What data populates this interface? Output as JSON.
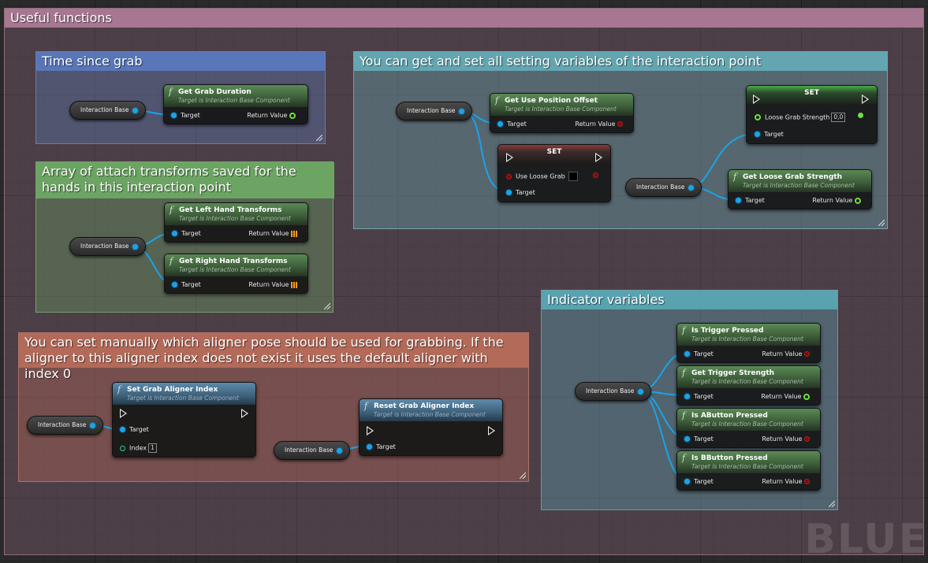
{
  "comments": {
    "useful": "Useful functions",
    "time": "Time since grab",
    "settings": "You can get and set all setting variables of the interaction point",
    "array": "Array of attach transforms saved for the hands in this interaction point",
    "aligner": "You can set manually which aligner pose should be used for grabbing. If the aligner to this aligner index does not exist it uses the default aligner with index 0",
    "indicator": "Indicator variables"
  },
  "labels": {
    "interaction_base": "Interaction Base",
    "target": "Target",
    "return_value": "Return Value",
    "target_is": "Target is Interaction Base Component",
    "set": "SET",
    "index": "Index",
    "fx": "f"
  },
  "nodes": {
    "get_grab_duration": "Get Grab Duration",
    "get_left_hand": "Get Left Hand Transforms",
    "get_right_hand": "Get Right Hand Transforms",
    "get_use_position_offset": "Get Use Position Offset",
    "set_use_loose_grab": "Use Loose Grab",
    "set_loose_grab_strength": "Loose Grab Strength",
    "loose_grab_value": "0,0",
    "get_loose_grab_strength": "Get Loose Grab Strength",
    "set_grab_aligner_index": "Set Grab Aligner Index",
    "index_value": "1",
    "reset_grab_aligner_index": "Reset Grab Aligner Index",
    "is_trigger_pressed": "Is Trigger Pressed",
    "get_trigger_strength": "Get Trigger Strength",
    "is_abutton_pressed": "Is AButton Pressed",
    "is_bbutton_pressed": "Is BButton Pressed"
  },
  "watermark": "BLUE",
  "colors": {
    "useful_comment": "#a0708a",
    "time_comment": "#5a78b4",
    "settings_comment": "#6aa8b4",
    "array_comment": "#6aa064",
    "aligner_comment": "#b46a5a",
    "indicator_comment": "#5aa0b0",
    "object_pin": "#1aa3e8",
    "bool_pin": "#b02020",
    "float_pin": "#70e040",
    "transform_pin": "#ff9a1a"
  }
}
